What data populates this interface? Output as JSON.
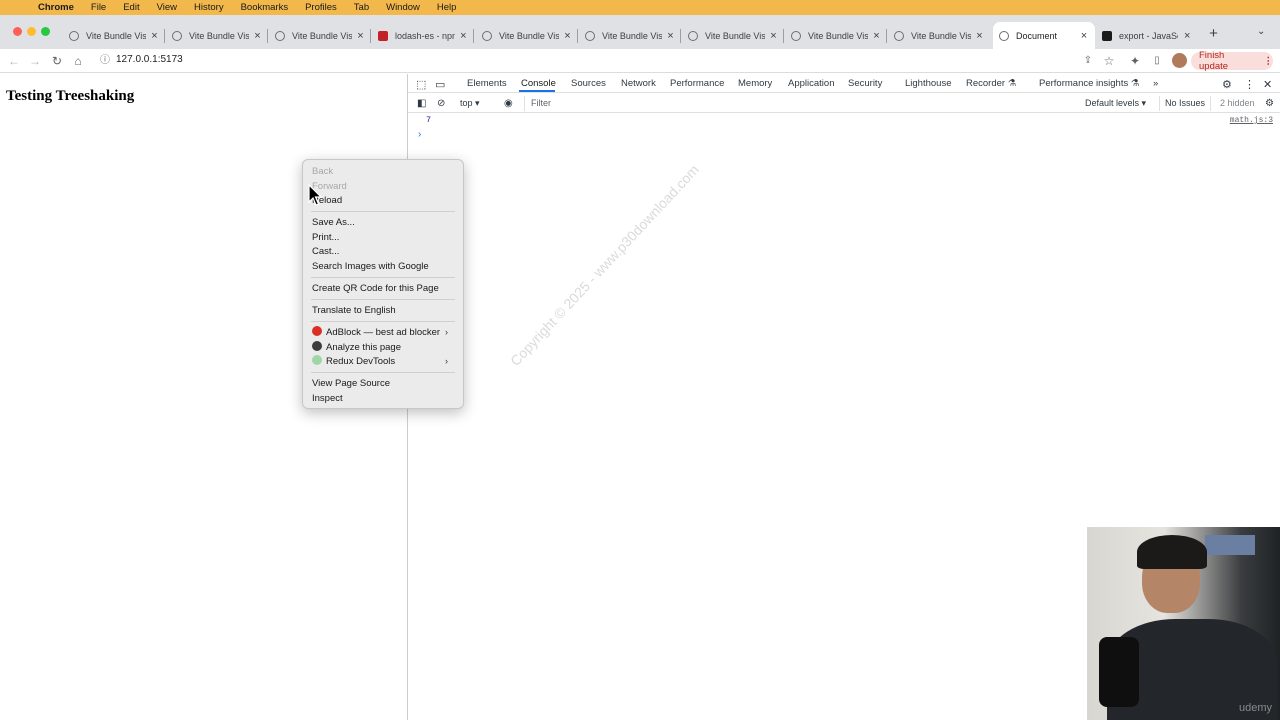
{
  "menubar": {
    "items": [
      "Chrome",
      "File",
      "Edit",
      "View",
      "History",
      "Bookmarks",
      "Profiles",
      "Tab",
      "Window",
      "Help"
    ]
  },
  "tabs": [
    {
      "title": "Vite Bundle Visu",
      "active": false
    },
    {
      "title": "Vite Bundle Visu",
      "active": false
    },
    {
      "title": "Vite Bundle Visu",
      "active": false
    },
    {
      "title": "lodash-es - npm",
      "active": false
    },
    {
      "title": "Vite Bundle Visu",
      "active": false
    },
    {
      "title": "Vite Bundle Visu",
      "active": false
    },
    {
      "title": "Vite Bundle Visu",
      "active": false
    },
    {
      "title": "Vite Bundle Visu",
      "active": false
    },
    {
      "title": "Vite Bundle Visu",
      "active": false
    },
    {
      "title": "Document",
      "active": true
    },
    {
      "title": "export - JavaSc",
      "active": false
    }
  ],
  "toolbar": {
    "url": "127.0.0.1:5173",
    "finish_update": "Finish update"
  },
  "page": {
    "heading": "Testing Treeshaking"
  },
  "devtools": {
    "tabs": [
      "Elements",
      "Console",
      "Sources",
      "Network",
      "Performance",
      "Memory",
      "Application",
      "Security",
      "Lighthouse",
      "Recorder ⚗",
      "Performance insights ⚗"
    ],
    "active_tab": "Console",
    "more": "»",
    "console_bar": {
      "context": "top",
      "filter_placeholder": "Filter",
      "levels": "Default levels",
      "issues": "No Issues",
      "hidden": "2 hidden"
    },
    "console_output": [
      {
        "value": "7",
        "source": "math.js:3"
      }
    ],
    "prompt": "›"
  },
  "context_menu": {
    "items": [
      {
        "label": "Back",
        "disabled": true
      },
      {
        "label": "Forward",
        "disabled": true
      },
      {
        "label": "Reload",
        "disabled": false
      },
      {
        "label": "Save As...",
        "disabled": false
      },
      {
        "label": "Print...",
        "disabled": false
      },
      {
        "label": "Cast...",
        "disabled": false
      },
      {
        "label": "Search Images with Google",
        "disabled": false
      },
      {
        "label": "Create QR Code for this Page",
        "disabled": false
      },
      {
        "label": "Translate to English",
        "disabled": false
      },
      {
        "label": "AdBlock — best ad blocker",
        "disabled": false
      },
      {
        "label": "Analyze this page",
        "disabled": false
      },
      {
        "label": "Redux DevTools",
        "disabled": false
      },
      {
        "label": "View Page Source",
        "disabled": false
      },
      {
        "label": "Inspect",
        "disabled": false
      }
    ]
  },
  "watermark": "Copyright © 2025 - www.p30download.com",
  "webcam": {
    "brand": "udemy"
  },
  "colors": {
    "menubar": "#f2b84b",
    "tabstrip": "#dfe1e5",
    "accent": "#1a73e8",
    "finish_update_bg": "#f9dedc",
    "finish_update_text": "#b3261e"
  }
}
